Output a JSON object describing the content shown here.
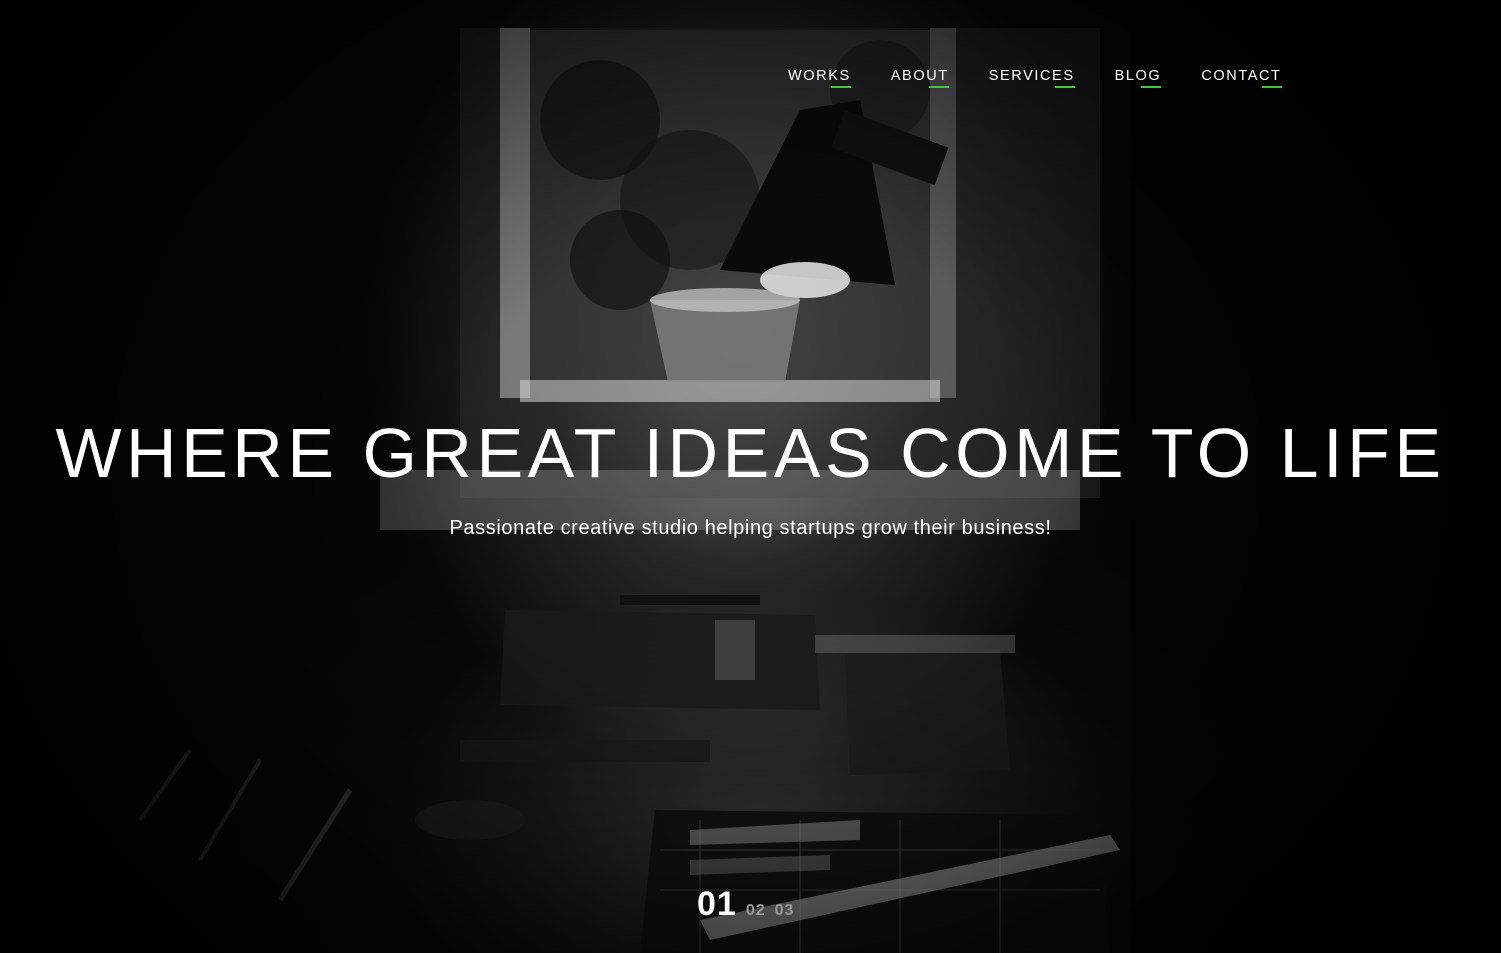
{
  "nav": {
    "items": [
      {
        "label": "WORKS"
      },
      {
        "label": "ABOUT"
      },
      {
        "label": "SERVICES"
      },
      {
        "label": "BLOG"
      },
      {
        "label": "CONTACT"
      }
    ],
    "accent_color": "#3ec63e"
  },
  "hero": {
    "headline": "WHERE GREAT IDEAS COME TO LIFE",
    "subtitle": "Passionate creative studio helping startups grow their business!",
    "background_image": "black-and-white photo of a desk by a window with a lamp, potted plant and drafting tools"
  },
  "slider": {
    "current": "01",
    "others": [
      "02",
      "03"
    ]
  }
}
